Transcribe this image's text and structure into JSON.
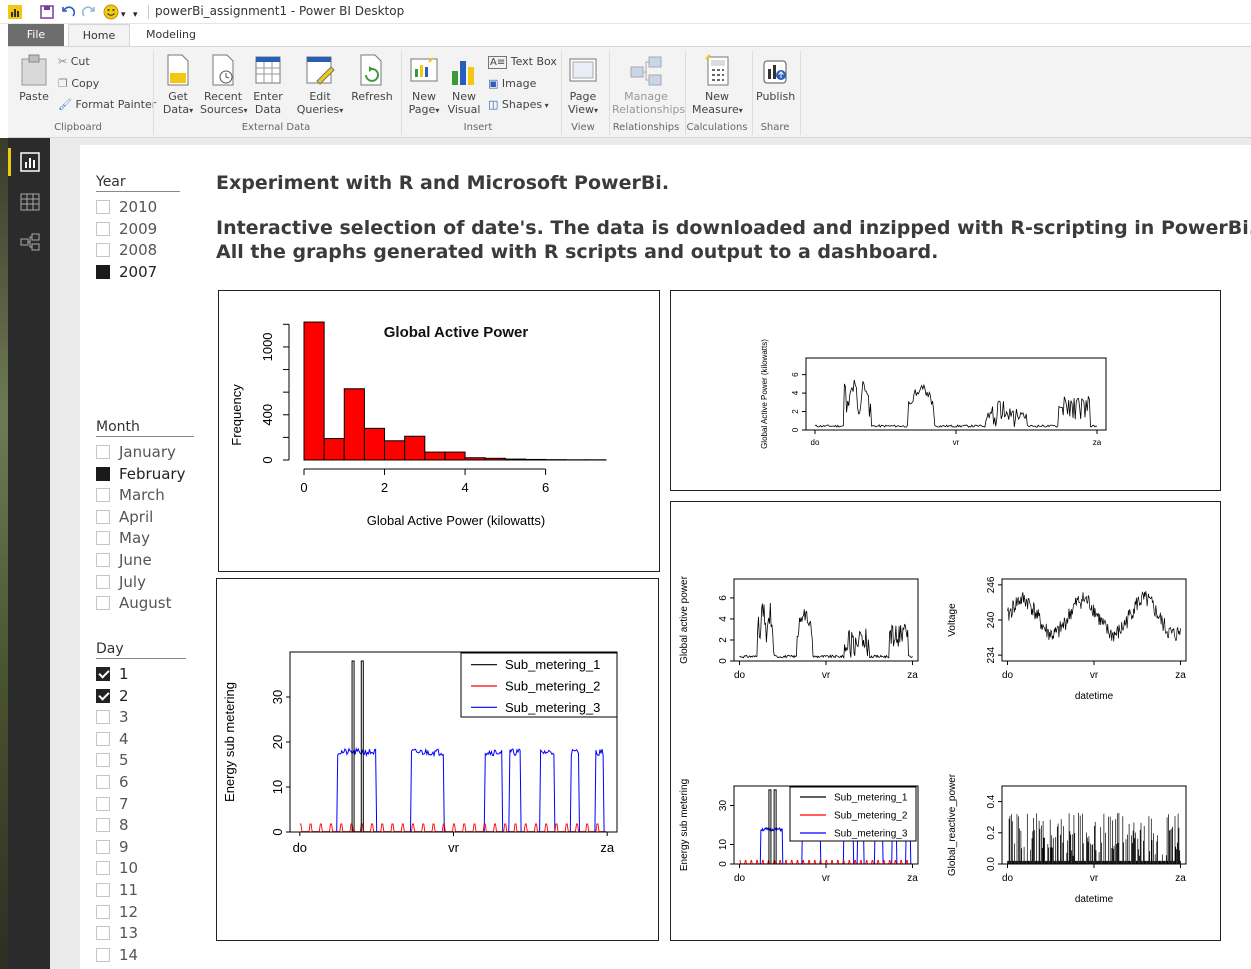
{
  "window": {
    "title": "powerBi_assignment1 - Power BI Desktop"
  },
  "tabs": {
    "file": "File",
    "home": "Home",
    "modeling": "Modeling"
  },
  "ribbon": {
    "paste": "Paste",
    "cut": "Cut",
    "copy": "Copy",
    "format_painter": "Format Painter",
    "get_data_1": "Get",
    "get_data_2": "Data",
    "recent_sources_1": "Recent",
    "recent_sources_2": "Sources",
    "enter_data_1": "Enter",
    "enter_data_2": "Data",
    "edit_queries_1": "Edit",
    "edit_queries_2": "Queries",
    "refresh": "Refresh",
    "new_page_1": "New",
    "new_page_2": "Page",
    "new_visual_1": "New",
    "new_visual_2": "Visual",
    "text_box": "Text Box",
    "image": "Image",
    "shapes": "Shapes",
    "page_view_1": "Page",
    "page_view_2": "View",
    "manage_rel_1": "Manage",
    "manage_rel_2": "Relationships",
    "new_measure_1": "New",
    "new_measure_2": "Measure",
    "publish": "Publish",
    "groups": {
      "clipboard": "Clipboard",
      "external_data": "External Data",
      "insert": "Insert",
      "view": "View",
      "relationships": "Relationships",
      "calculations": "Calculations",
      "share": "Share"
    }
  },
  "slicers": {
    "year": {
      "title": "Year",
      "items": [
        {
          "label": "2010",
          "selected": false
        },
        {
          "label": "2009",
          "selected": false
        },
        {
          "label": "2008",
          "selected": false
        },
        {
          "label": "2007",
          "selected": true
        }
      ]
    },
    "month": {
      "title": "Month",
      "items": [
        {
          "label": "January",
          "selected": false
        },
        {
          "label": "February",
          "selected": true
        },
        {
          "label": "March",
          "selected": false
        },
        {
          "label": "April",
          "selected": false
        },
        {
          "label": "May",
          "selected": false
        },
        {
          "label": "June",
          "selected": false
        },
        {
          "label": "July",
          "selected": false
        },
        {
          "label": "August",
          "selected": false
        }
      ]
    },
    "day": {
      "title": "Day",
      "items": [
        {
          "label": "1",
          "selected": true
        },
        {
          "label": "2",
          "selected": true
        },
        {
          "label": "3",
          "selected": false
        },
        {
          "label": "4",
          "selected": false
        },
        {
          "label": "5",
          "selected": false
        },
        {
          "label": "6",
          "selected": false
        },
        {
          "label": "7",
          "selected": false
        },
        {
          "label": "8",
          "selected": false
        },
        {
          "label": "9",
          "selected": false
        },
        {
          "label": "10",
          "selected": false
        },
        {
          "label": "11",
          "selected": false
        },
        {
          "label": "12",
          "selected": false
        },
        {
          "label": "13",
          "selected": false
        },
        {
          "label": "14",
          "selected": false
        }
      ]
    }
  },
  "headings": {
    "line1": "Experiment with R and Microsoft PowerBi.",
    "line2": "Interactive selection of date's. The data is downloaded and inzipped with R-scripting in PowerBi.",
    "line3": "All the graphs generated with R scripts and output to a dashboard."
  },
  "colors": {
    "hist": "#ff0000",
    "sub1": "#000000",
    "sub2": "#ff0000",
    "sub3": "#0000ff",
    "yellow_accent": "#f2c811"
  },
  "chart_data": [
    {
      "type": "bar",
      "title": "Global Active Power",
      "xlabel": "Global Active Power (kilowatts)",
      "ylabel": "Frequency",
      "bin_edges": [
        0,
        0.5,
        1,
        1.5,
        2,
        2.5,
        3,
        3.5,
        4,
        4.5,
        5,
        5.5,
        6,
        6.5,
        7,
        7.5
      ],
      "values": [
        1220,
        190,
        630,
        280,
        170,
        210,
        70,
        70,
        20,
        15,
        8,
        5,
        3,
        2,
        2
      ],
      "xticks": [
        "0",
        "2",
        "4",
        "6"
      ],
      "yticks": [
        "0",
        "400",
        "1000"
      ],
      "ylim": [
        0,
        1300
      ],
      "colors": [
        "#ff0000"
      ]
    },
    {
      "type": "line",
      "title": "",
      "xlabel": "",
      "ylabel": "Global Active Power (kilowatts)",
      "x_ticks": [
        "do",
        "vr",
        "za"
      ],
      "y_ticks": [
        "0",
        "2",
        "4",
        "6"
      ],
      "ylim": [
        0,
        7.8
      ]
    },
    {
      "type": "line",
      "title": "",
      "ylabel": "Energy sub metering",
      "x_ticks": [
        "do",
        "vr",
        "za"
      ],
      "y_ticks": [
        "0",
        "10",
        "20",
        "30"
      ],
      "ylim": [
        0,
        40
      ],
      "series": [
        {
          "name": "Sub_metering_1"
        },
        {
          "name": "Sub_metering_2"
        },
        {
          "name": "Sub_metering_3"
        }
      ]
    },
    {
      "type": "line",
      "ylabel": "Global active power",
      "x_ticks": [
        "do",
        "vr",
        "za"
      ],
      "y_ticks": [
        "0",
        "2",
        "4",
        "6"
      ],
      "ylim": [
        0,
        7.8
      ]
    },
    {
      "type": "line",
      "ylabel": "Voltage",
      "xlabel": "datetime",
      "x_ticks": [
        "do",
        "vr",
        "za"
      ],
      "y_ticks": [
        "234",
        "240",
        "246"
      ],
      "ylim": [
        233,
        247
      ]
    },
    {
      "type": "line",
      "ylabel": "Energy sub metering",
      "x_ticks": [
        "do",
        "vr",
        "za"
      ],
      "y_ticks": [
        "0",
        "10",
        "30"
      ],
      "ylim": [
        0,
        40
      ],
      "series": [
        {
          "name": "Sub_metering_1"
        },
        {
          "name": "Sub_metering_2"
        },
        {
          "name": "Sub_metering_3"
        }
      ]
    },
    {
      "type": "bar",
      "ylabel": "Global_reactive_power",
      "xlabel": "datetime",
      "x_ticks": [
        "do",
        "vr",
        "za"
      ],
      "y_ticks": [
        "0.0",
        "0.2",
        "0.4"
      ],
      "ylim": [
        0,
        0.5
      ]
    }
  ]
}
